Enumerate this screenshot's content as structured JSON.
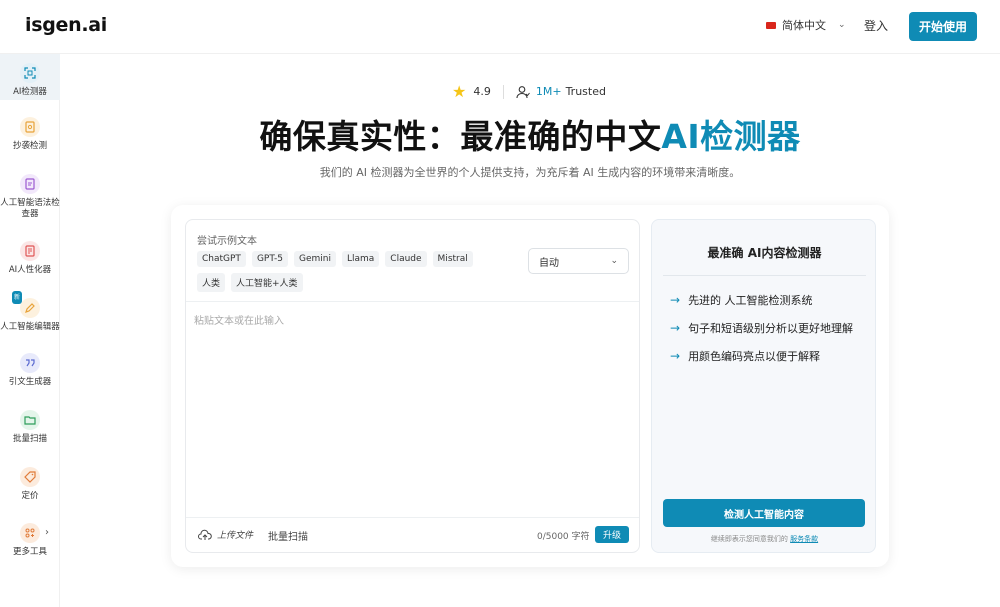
{
  "header": {
    "logo": "isgen.ai",
    "language": "简体中文",
    "login": "登入",
    "start": "开始使用"
  },
  "sidebar": {
    "items": [
      {
        "label": "AI检测器",
        "icon": "ai-scan-icon",
        "color": "#0f8bb5"
      },
      {
        "label": "抄袭检测",
        "icon": "plagiarism-icon",
        "color": "#e8a33a"
      },
      {
        "label": "人工智能语法检查器",
        "icon": "grammar-icon",
        "color": "#9b59d0"
      },
      {
        "label": "AI人性化器",
        "icon": "humanizer-icon",
        "color": "#e05656"
      },
      {
        "label": "人工智能编辑器",
        "icon": "editor-icon",
        "color": "#e8a33a",
        "badge": "新"
      },
      {
        "label": "引文生成器",
        "icon": "citation-icon",
        "color": "#5b6ad0"
      },
      {
        "label": "批量扫描",
        "icon": "folder-icon",
        "color": "#2e9e5b"
      },
      {
        "label": "定价",
        "icon": "price-tag-icon",
        "color": "#e07b3a"
      },
      {
        "label": "更多工具",
        "icon": "more-tools-icon",
        "color": "#e07b3a"
      }
    ]
  },
  "hero": {
    "rating": "4.9",
    "users": "1M+",
    "trusted": "Trusted",
    "title_main": "确保真实性：最准确的中文",
    "title_accent": "AI检测器",
    "subtitle": "我们的 AI 检测器为全世界的个人提供支持，为充斥着 AI 生成内容的环境带来清晰度。"
  },
  "editor": {
    "try_label": "尝试示例文本",
    "chips": [
      "ChatGPT",
      "GPT-5",
      "Gemini",
      "Llama",
      "Claude",
      "Mistral",
      "人类",
      "人工智能+人类"
    ],
    "select_value": "自动",
    "placeholder": "粘贴文本或在此输入",
    "upload": "上传文件",
    "batch": "批量扫描",
    "counter": "0/5000 字符",
    "upgrade": "升级"
  },
  "panel": {
    "title": "最准确 AI内容检测器",
    "features": [
      "先进的 人工智能检测系统",
      "句子和短语级别分析以更好地理解",
      "用颜色编码亮点以便于解释"
    ],
    "detect_button": "检测人工智能内容",
    "terms_prefix": "继续即表示您同意我们的",
    "terms_link": "服务条款"
  }
}
